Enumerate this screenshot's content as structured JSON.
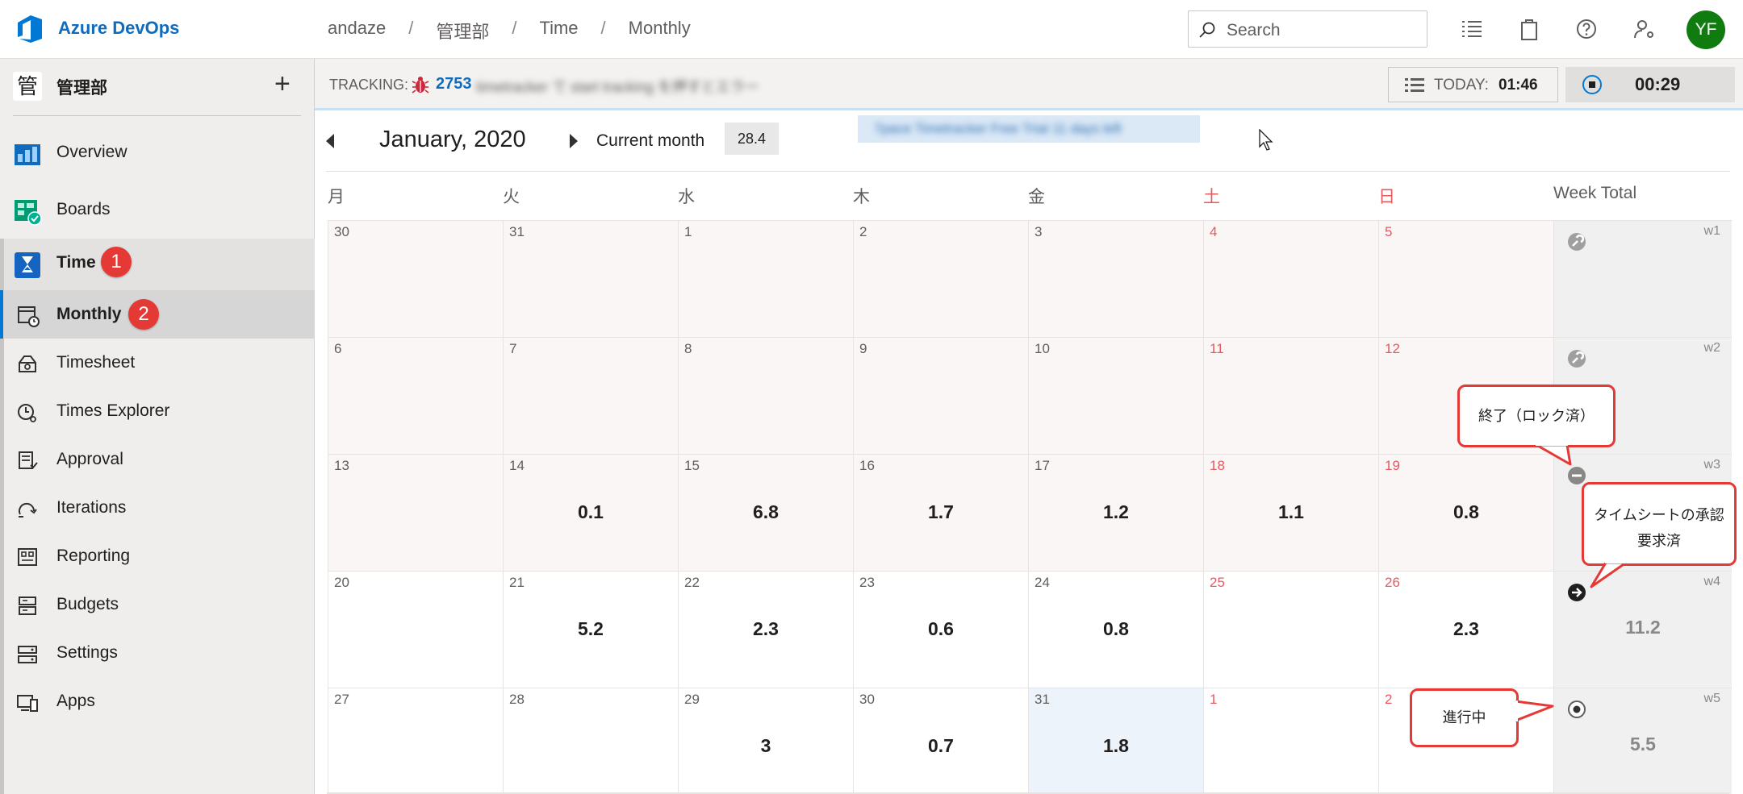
{
  "app": {
    "product": "Azure DevOps"
  },
  "breadcrumb": [
    "andaze",
    "管理部",
    "Time",
    "Monthly"
  ],
  "search": {
    "placeholder": "Search"
  },
  "user": {
    "initials": "YF"
  },
  "colors": {
    "accent": "#0078d4",
    "weekend": "#e8585f",
    "callout": "#e53935",
    "avatar": "#107c10"
  },
  "sidebar": {
    "project_icon": "管",
    "project_name": "管理部",
    "items": [
      {
        "label": "Overview",
        "icon": "overview-icon"
      },
      {
        "label": "Boards",
        "icon": "boards-icon"
      },
      {
        "label": "Time",
        "icon": "hourglass-icon",
        "badge": "1"
      },
      {
        "label": "Monthly",
        "icon": "calendar-clock-icon",
        "badge": "2"
      },
      {
        "label": "Timesheet",
        "icon": "timesheet-icon"
      },
      {
        "label": "Times Explorer",
        "icon": "clock-search-icon"
      },
      {
        "label": "Approval",
        "icon": "approval-icon"
      },
      {
        "label": "Iterations",
        "icon": "iterations-icon"
      },
      {
        "label": "Reporting",
        "icon": "reporting-icon"
      },
      {
        "label": "Budgets",
        "icon": "budgets-icon"
      },
      {
        "label": "Settings",
        "icon": "settings-icon"
      },
      {
        "label": "Apps",
        "icon": "apps-icon"
      }
    ]
  },
  "tracking": {
    "label": "TRACKING:",
    "item_id": "2753",
    "item_title": "timetracker で start tracking を押すとエラー",
    "today_label": "TODAY:",
    "today_value": "01:46",
    "timer_value": "00:29"
  },
  "month_header": {
    "title": "January, 2020",
    "current_label": "Current month",
    "total": "28.4",
    "trial_banner": "7pace Timetracker Free Trial  11 days left"
  },
  "calendar": {
    "weekdays": [
      "月",
      "火",
      "水",
      "木",
      "金",
      "土",
      "日"
    ],
    "week_total_label": "Week Total",
    "weeks": [
      {
        "label": "w1",
        "status": "locked",
        "total": "",
        "days": [
          {
            "d": "30",
            "v": ""
          },
          {
            "d": "31",
            "v": ""
          },
          {
            "d": "1",
            "v": ""
          },
          {
            "d": "2",
            "v": ""
          },
          {
            "d": "3",
            "v": ""
          },
          {
            "d": "4",
            "v": ""
          },
          {
            "d": "5",
            "v": ""
          }
        ]
      },
      {
        "label": "w2",
        "status": "locked",
        "total": "",
        "days": [
          {
            "d": "6",
            "v": ""
          },
          {
            "d": "7",
            "v": ""
          },
          {
            "d": "8",
            "v": ""
          },
          {
            "d": "9",
            "v": ""
          },
          {
            "d": "10",
            "v": ""
          },
          {
            "d": "11",
            "v": ""
          },
          {
            "d": "12",
            "v": ""
          }
        ]
      },
      {
        "label": "w3",
        "status": "closed",
        "total": "",
        "days": [
          {
            "d": "13",
            "v": ""
          },
          {
            "d": "14",
            "v": "0.1"
          },
          {
            "d": "15",
            "v": "6.8"
          },
          {
            "d": "16",
            "v": "1.7"
          },
          {
            "d": "17",
            "v": "1.2"
          },
          {
            "d": "18",
            "v": "1.1"
          },
          {
            "d": "19",
            "v": "0.8"
          }
        ]
      },
      {
        "label": "w4",
        "status": "submitted",
        "total": "11.2",
        "days": [
          {
            "d": "20",
            "v": ""
          },
          {
            "d": "21",
            "v": "5.2"
          },
          {
            "d": "22",
            "v": "2.3"
          },
          {
            "d": "23",
            "v": "0.6"
          },
          {
            "d": "24",
            "v": "0.8"
          },
          {
            "d": "25",
            "v": ""
          },
          {
            "d": "26",
            "v": "2.3"
          }
        ]
      },
      {
        "label": "w5",
        "status": "in-progress",
        "total": "5.5",
        "days": [
          {
            "d": "27",
            "v": ""
          },
          {
            "d": "28",
            "v": ""
          },
          {
            "d": "29",
            "v": "3"
          },
          {
            "d": "30",
            "v": "0.7"
          },
          {
            "d": "31",
            "v": "1.8"
          },
          {
            "d": "1",
            "v": ""
          },
          {
            "d": "2",
            "v": ""
          }
        ]
      }
    ]
  },
  "callouts": {
    "closed": "終了（ロック済）",
    "submitted_line1": "タイムシートの承認",
    "submitted_line2": "要求済",
    "in_progress": "進行中"
  }
}
